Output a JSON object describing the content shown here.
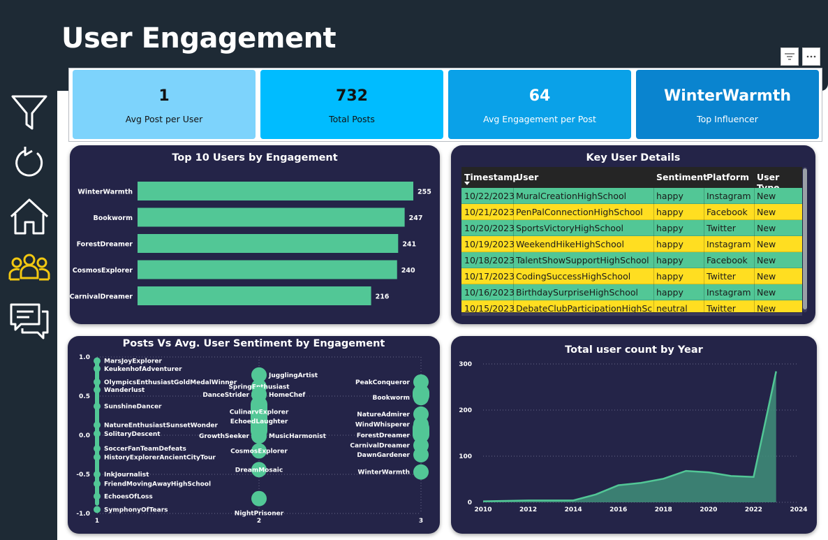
{
  "page": {
    "title": "User Engagement"
  },
  "nav": {
    "items": [
      {
        "icon": "filter-icon",
        "name": "nav-filter"
      },
      {
        "icon": "reset-icon",
        "name": "nav-reset"
      },
      {
        "icon": "home-icon",
        "name": "nav-home"
      },
      {
        "icon": "users-icon",
        "name": "nav-users",
        "active": true
      },
      {
        "icon": "chat-icon",
        "name": "nav-chat"
      }
    ],
    "active_color": "#f2c811",
    "color": "#ffffff"
  },
  "kpis": [
    {
      "value": "1",
      "label": "Avg Post per User",
      "bg": "#7dd3fc",
      "fg": "#111111"
    },
    {
      "value": "732",
      "label": "Total Posts",
      "bg": "#00bcff",
      "fg": "#111111"
    },
    {
      "value": "64",
      "label": "Avg Engagement per Post",
      "bg": "#0aa1e8",
      "fg": "#ffffff"
    },
    {
      "value": "WinterWarmth",
      "label": "Top Influencer",
      "bg": "#0a84cf",
      "fg": "#ffffff"
    }
  ],
  "bar_panel": {
    "title": "Top 10 Users by Engagement"
  },
  "table_panel": {
    "title": "Key User Details",
    "columns": [
      "Timestamp",
      "User",
      "Sentiment",
      "Platform",
      "User Type"
    ],
    "rows": [
      [
        "10/22/2023",
        "MuralCreationHighSchool",
        "happy",
        "Instagram",
        "New"
      ],
      [
        "10/21/2023",
        "PenPalConnectionHighSchool",
        "happy",
        "Facebook",
        "New"
      ],
      [
        "10/20/2023",
        "SportsVictoryHighSchool",
        "happy",
        "Twitter",
        "New"
      ],
      [
        "10/19/2023",
        "WeekendHikeHighSchool",
        "happy",
        "Instagram",
        "New"
      ],
      [
        "10/18/2023",
        "TalentShowSupportHighSchool",
        "happy",
        "Facebook",
        "New"
      ],
      [
        "10/17/2023",
        "CodingSuccessHighSchool",
        "happy",
        "Twitter",
        "New"
      ],
      [
        "10/16/2023",
        "BirthdaySurpriseHighSchool",
        "happy",
        "Instagram",
        "New"
      ],
      [
        "10/15/2023",
        "DebateClubParticipationHighSch",
        "neutral",
        "Twitter",
        "New"
      ]
    ],
    "row_colors": [
      "#52c796",
      "#ffde21"
    ]
  },
  "scatter_panel": {
    "title": "Posts Vs Avg. User Sentiment by Engagement"
  },
  "area_panel": {
    "title": "Total user count by Year"
  },
  "colors": {
    "accent": "#52c796",
    "panel_bg": "#242448",
    "header_bg": "#1e2a35"
  },
  "chart_data": [
    {
      "type": "bar",
      "orientation": "horizontal",
      "title": "Top 10 Users by Engagement",
      "categories": [
        "WinterWarmth",
        "Bookworm",
        "ForestDreamer",
        "CosmosExplorer",
        "CarnivalDreamer"
      ],
      "values": [
        255,
        247,
        241,
        240,
        216
      ],
      "color": "#52c796"
    },
    {
      "type": "scatter",
      "title": "Posts Vs Avg. User Sentiment by Engagement",
      "xlim": [
        1,
        3
      ],
      "ylim": [
        -1.0,
        1.0
      ],
      "x_ticks": [
        1,
        2,
        3
      ],
      "y_ticks": [
        1.0,
        0.5,
        0.0,
        -0.5,
        -1.0
      ],
      "points": [
        {
          "name": "MarsJoyExplorer",
          "x": 1,
          "y": 0.95
        },
        {
          "name": "KeukenhofAdventurer",
          "x": 1,
          "y": 0.85
        },
        {
          "name": "OlympicsEnthusiastGoldMedalWinner",
          "x": 1,
          "y": 0.68
        },
        {
          "name": "Wanderlust",
          "x": 1,
          "y": 0.58
        },
        {
          "name": "SunshineDancer",
          "x": 1,
          "y": 0.37
        },
        {
          "name": "NatureEnthusiastSunsetWonder",
          "x": 1,
          "y": 0.13
        },
        {
          "name": "SolitaryDescent",
          "x": 1,
          "y": 0.02
        },
        {
          "name": "SoccerFanTeamDefeats",
          "x": 1,
          "y": -0.17
        },
        {
          "name": "HistoryExplorerAncientCityTour",
          "x": 1,
          "y": -0.28
        },
        {
          "name": "InkJournalist",
          "x": 1,
          "y": -0.5
        },
        {
          "name": "FriendMovingAwayHighSchool",
          "x": 1,
          "y": -0.62
        },
        {
          "name": "EchoesOfLoss",
          "x": 1,
          "y": -0.78
        },
        {
          "name": "SymphonyOfTears",
          "x": 1,
          "y": -0.95
        },
        {
          "name": "JugglingArtist",
          "x": 2,
          "y": 0.77
        },
        {
          "name": "SpringEnthusiast",
          "x": 2,
          "y": 0.62
        },
        {
          "name": "DanceStrider",
          "x": 2,
          "y": 0.52
        },
        {
          "name": "HomeChef",
          "x": 2,
          "y": 0.52
        },
        {
          "name": "CulinaryExplorer",
          "x": 2,
          "y": 0.3
        },
        {
          "name": "EchoedLaughter",
          "x": 2,
          "y": 0.18
        },
        {
          "name": "GrowthSeeker",
          "x": 2,
          "y": -0.01
        },
        {
          "name": "MusicHarmonist",
          "x": 2,
          "y": -0.01
        },
        {
          "name": "CosmosExplorer",
          "x": 2,
          "y": -0.2
        },
        {
          "name": "DreamMosaic",
          "x": 2,
          "y": -0.44
        },
        {
          "name": "NightPrisoner",
          "x": 2,
          "y": -0.81
        },
        {
          "name": "PeakConqueror",
          "x": 3,
          "y": 0.68
        },
        {
          "name": "Bookworm",
          "x": 3,
          "y": 0.48
        },
        {
          "name": "NatureAdmirer",
          "x": 3,
          "y": 0.27
        },
        {
          "name": "WindWhisperer",
          "x": 3,
          "y": 0.14
        },
        {
          "name": "ForestDreamer",
          "x": 3,
          "y": 0.0
        },
        {
          "name": "CarnivalDreamer",
          "x": 3,
          "y": -0.13
        },
        {
          "name": "DawnGardener",
          "x": 3,
          "y": -0.25
        },
        {
          "name": "WinterWarmth",
          "x": 3,
          "y": -0.47
        }
      ],
      "color": "#52c796"
    },
    {
      "type": "area",
      "title": "Total user count by Year",
      "x": [
        2010,
        2011,
        2012,
        2013,
        2014,
        2015,
        2016,
        2017,
        2018,
        2019,
        2020,
        2021,
        2022,
        2023
      ],
      "values": [
        2,
        3,
        4,
        4,
        4,
        17,
        37,
        42,
        51,
        68,
        65,
        57,
        55,
        284
      ],
      "xlim": [
        2010,
        2024
      ],
      "ylim": [
        0,
        300
      ],
      "x_ticks": [
        2010,
        2012,
        2014,
        2016,
        2018,
        2020,
        2022,
        2024
      ],
      "y_ticks": [
        0,
        100,
        200,
        300
      ],
      "color": "#52c796"
    }
  ]
}
